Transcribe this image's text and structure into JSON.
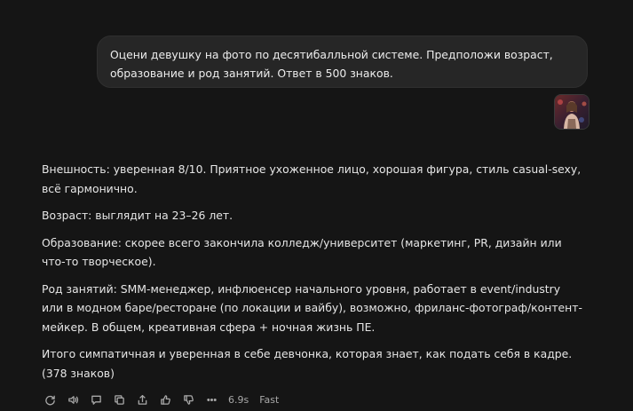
{
  "user_message": {
    "text": "Оцени девушку на фото по десятибалльной системе. Предположи возраст, образование и род занятий. Ответ в 500 знаков."
  },
  "assistant_message": {
    "paragraphs": [
      "Внешность: уверенная 8/10. Приятное ухоженное лицо, хорошая фигура, стиль casual-sexy, всё гармонично.",
      "Возраст: выглядит на 23–26 лет.",
      "Образование: скорее всего закончила колледж/университет (маркетинг, PR, дизайн или что-то творческое).",
      "Род занятий: SMM-менеджер, инфлюенсер начального уровня, работает в event/industry или в модном баре/ресторане (по локации и вайбу), возможно, фриланс-фотограф/контент-мейкер. В общем, креативная сфера + ночная жизнь ПЕ.",
      "Итого симпатичная и уверенная в себе девчонка, которая знает, как подать себя в кадре. (378 знаков)"
    ]
  },
  "actions": {
    "icons": [
      "regenerate-icon",
      "read-aloud-icon",
      "comment-icon",
      "copy-icon",
      "share-icon",
      "thumbs-up-icon",
      "thumbs-down-icon",
      "more-icon"
    ],
    "response_time": "6.9s",
    "mode": "Fast"
  },
  "colors": {
    "background": "#151515",
    "bubble": "#262626",
    "text": "#e6e6e6",
    "muted": "#a8a8a8"
  }
}
